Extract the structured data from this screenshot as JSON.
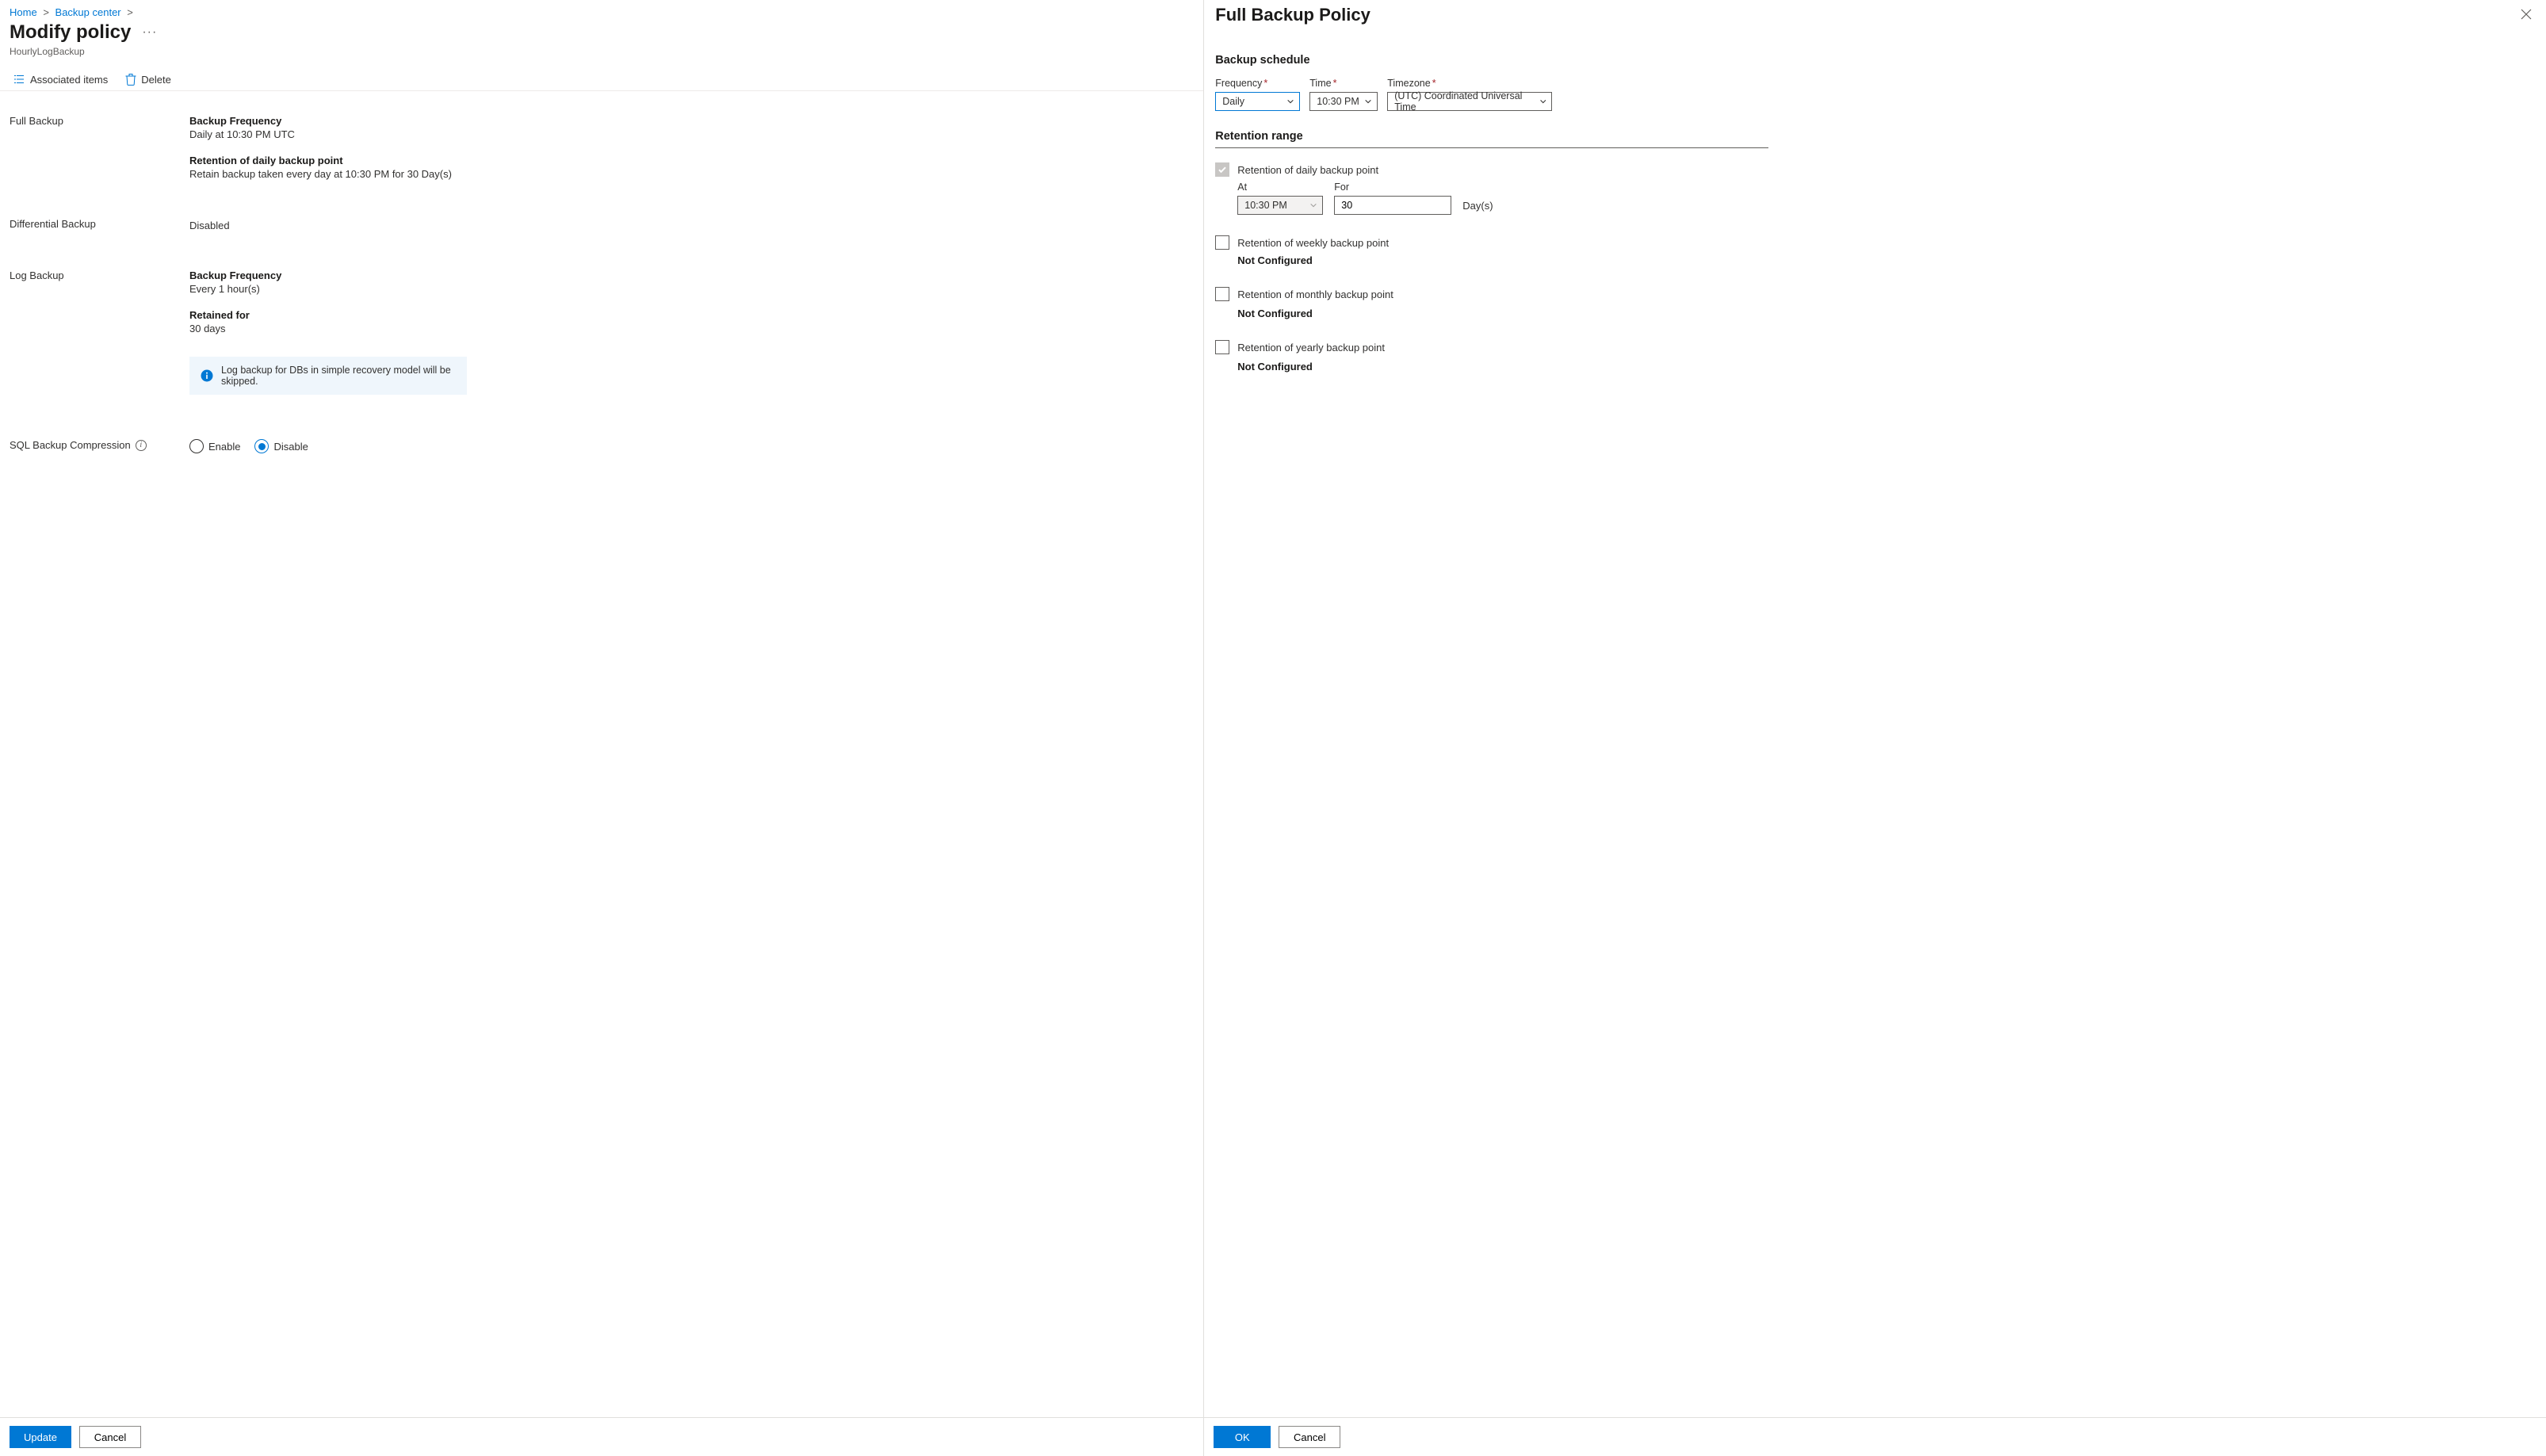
{
  "breadcrumb": {
    "home": "Home",
    "backup_center": "Backup center"
  },
  "page": {
    "title": "Modify policy",
    "subtitle": "HourlyLogBackup"
  },
  "commands": {
    "associated_items": "Associated items",
    "delete": "Delete"
  },
  "summary": {
    "full_backup": {
      "label": "Full Backup",
      "freq_heading": "Backup Frequency",
      "freq_value": "Daily at 10:30 PM UTC",
      "retention_heading": "Retention of daily backup point",
      "retention_value": "Retain backup taken every day at 10:30 PM for 30 Day(s)"
    },
    "differential": {
      "label": "Differential Backup",
      "value": "Disabled"
    },
    "log_backup": {
      "label": "Log Backup",
      "freq_heading": "Backup Frequency",
      "freq_value": "Every 1 hour(s)",
      "retained_heading": "Retained for",
      "retained_value": "30 days",
      "infobox": "Log backup for DBs in simple recovery model will be skipped."
    },
    "compression": {
      "label": "SQL Backup Compression",
      "enable": "Enable",
      "disable": "Disable"
    }
  },
  "left_footer": {
    "update": "Update",
    "cancel": "Cancel"
  },
  "blade": {
    "title": "Full Backup Policy",
    "schedule_heading": "Backup schedule",
    "frequency_label": "Frequency",
    "frequency_value": "Daily",
    "time_label": "Time",
    "time_value": "10:30 PM",
    "timezone_label": "Timezone",
    "timezone_value": "(UTC) Coordinated Universal Time",
    "retention_heading": "Retention range",
    "daily": {
      "label": "Retention of daily backup point",
      "at_label": "At",
      "at_value": "10:30 PM",
      "for_label": "For",
      "for_value": "30",
      "unit": "Day(s)"
    },
    "weekly": {
      "label": "Retention of weekly backup point",
      "status": "Not Configured"
    },
    "monthly": {
      "label": "Retention of monthly backup point",
      "status": "Not Configured"
    },
    "yearly": {
      "label": "Retention of yearly backup point",
      "status": "Not Configured"
    }
  },
  "right_footer": {
    "ok": "OK",
    "cancel": "Cancel"
  }
}
